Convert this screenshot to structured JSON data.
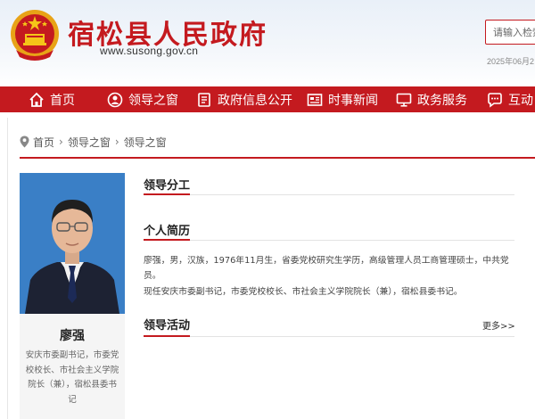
{
  "header": {
    "site_title": "宿松县人民政府",
    "site_url": "www.susong.gov.cn",
    "search_placeholder": "请输入检索",
    "date": "2025年06月2"
  },
  "nav": {
    "items": [
      {
        "label": "首页",
        "icon": "home-icon"
      },
      {
        "label": "领导之窗",
        "icon": "leader-icon"
      },
      {
        "label": "政府信息公开",
        "icon": "document-icon"
      },
      {
        "label": "时事新闻",
        "icon": "news-icon"
      },
      {
        "label": "政务服务",
        "icon": "monitor-icon"
      },
      {
        "label": "互动",
        "icon": "chat-icon"
      }
    ]
  },
  "breadcrumb": {
    "items": [
      "首页",
      "领导之窗",
      "领导之窗"
    ],
    "separator": "›"
  },
  "profile": {
    "name": "廖强",
    "description": "安庆市委副书记，市委党校校长、市社会主义学院院长（兼），宿松县委书记"
  },
  "sections": {
    "division": {
      "title": "领导分工"
    },
    "resume": {
      "title": "个人简历",
      "line1": "廖强，男，汉族，1976年11月生，省委党校研究生学历，高级管理人员工商管理硕士，中共党员。",
      "line2": "现任安庆市委副书记，市委党校校长、市社会主义学院院长（兼），宿松县委书记。"
    },
    "activities": {
      "title": "领导活动",
      "more": "更多>>"
    }
  },
  "colors": {
    "brand_red": "#c41a1f",
    "photo_bg": "#3a7fc6"
  }
}
